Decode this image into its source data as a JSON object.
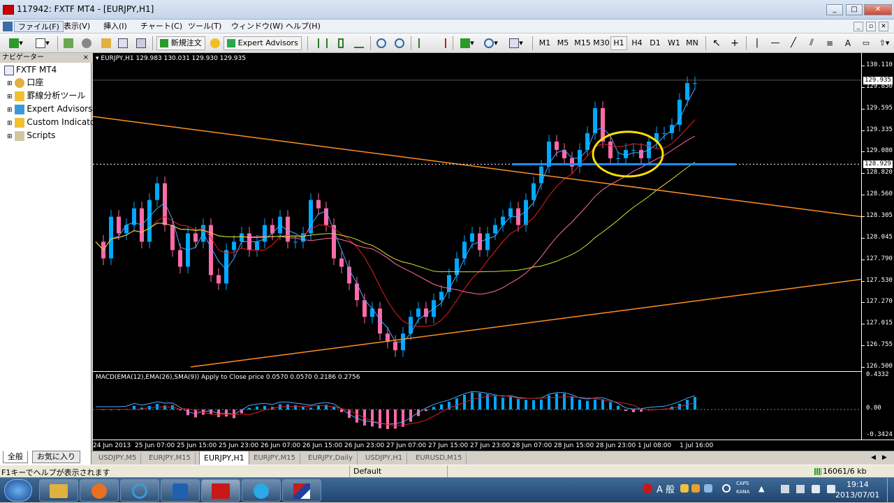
{
  "window": {
    "title": "117942: FXTF MT4 - [EURJPY,H1]",
    "controls": [
      "_",
      "□",
      "✕"
    ],
    "mdi_controls": [
      "_",
      "▫",
      "✕"
    ]
  },
  "menu": [
    {
      "label": "ファイル(F)"
    },
    {
      "label": "表示(V)"
    },
    {
      "label": "挿入(I)"
    },
    {
      "label": "チャート(C)"
    },
    {
      "label": "ツール(T)"
    },
    {
      "label": "ウィンドウ(W)"
    },
    {
      "label": "ヘルプ(H)"
    }
  ],
  "toolbar": {
    "new_order": "新規注文",
    "expert_advisors": "Expert Advisors",
    "timeframes": [
      "M1",
      "M5",
      "M15",
      "M30",
      "H1",
      "H4",
      "D1",
      "W1",
      "MN"
    ],
    "active_timeframe": "H1"
  },
  "navigator": {
    "header": "ナビゲーター",
    "root": "FXTF MT4",
    "items": [
      "口座",
      "罫線分析ツール",
      "Expert Advisors",
      "Custom Indicators",
      "Scripts"
    ],
    "tabs": [
      "全般",
      "お気に入り"
    ]
  },
  "chart": {
    "info": "EURJPY,H1  129.983 130.031 129.930 129.935",
    "current_price": "129.935",
    "hline_price": "128.929",
    "price_labels": [
      "130.110",
      "129.850",
      "129.595",
      "129.335",
      "129.080",
      "128.820",
      "128.560",
      "128.305",
      "128.045",
      "127.790",
      "127.530",
      "127.270",
      "127.015",
      "126.755",
      "126.500"
    ],
    "macd_info": "MACD(EMA(12),EMA(26),SMA(9)) Apply to Close price 0.0570 0.0570 0.2186 0.2756",
    "macd_labels": [
      "0.4332",
      "0.00",
      "-0.3424"
    ],
    "time_labels": [
      "24 Jun 2013",
      "25 Jun 07:00",
      "25 Jun 15:00",
      "25 Jun 23:00",
      "26 Jun 07:00",
      "26 Jun 15:00",
      "26 Jun 23:00",
      "27 Jun 07:00",
      "27 Jun 15:00",
      "27 Jun 23:00",
      "28 Jun 07:00",
      "28 Jun 15:00",
      "28 Jun 23:00",
      "1 Jul 08:00",
      "1 Jul 16:00"
    ],
    "colors": {
      "bull": "#00a8ff",
      "bear": "#ff6aa8",
      "ma_fast": "#4aa8ff",
      "ma_mid": "#e02020",
      "ma_slow": "#ff6aa8",
      "ma_long": "#d8e030",
      "trend": "#ff9020",
      "hline": "#1e90ff",
      "circle": "#ffe000"
    }
  },
  "chart_tabs": [
    "USDJPY,M5",
    "EURJPY,M15",
    "EURJPY,H1",
    "EURJPY,M15",
    "EURJPY,Daily",
    "USDJPY,H1",
    "EURUSD,M15"
  ],
  "active_chart_tab": "EURJPY,H1",
  "status": {
    "help": "F1キーでヘルプが表示されます",
    "profile": "Default",
    "traffic": "16061/6 kb"
  },
  "taskbar": {
    "tray_ime": "A 般",
    "caps": "CAPS",
    "kana": "KANA",
    "time": "19:14",
    "date": "2013/07/01"
  }
}
